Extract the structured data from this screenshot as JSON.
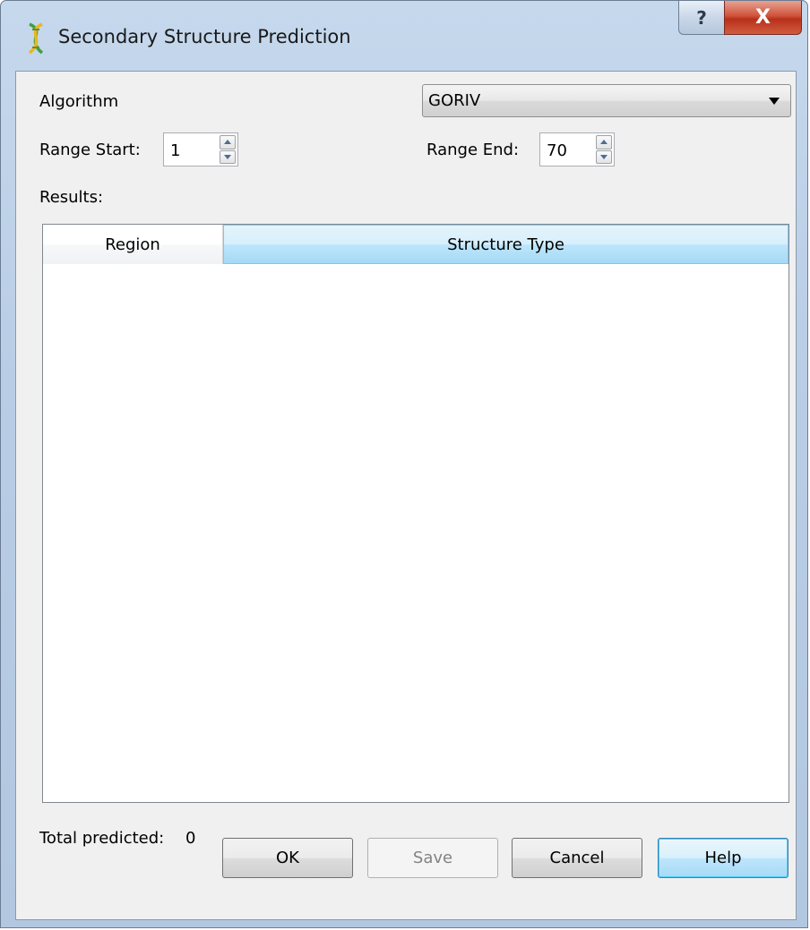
{
  "window": {
    "title": "Secondary Structure Prediction",
    "help_glyph": "?",
    "close_glyph": "X"
  },
  "form": {
    "algorithm_label": "Algorithm",
    "algorithm_value": "GORIV",
    "range_start_label": "Range Start:",
    "range_start_value": "1",
    "range_end_label": "Range End:",
    "range_end_value": "70",
    "results_label": "Results:"
  },
  "table": {
    "columns": [
      "Region",
      "Structure Type"
    ],
    "rows": []
  },
  "footer": {
    "total_label": "Total predicted:",
    "total_value": "0"
  },
  "buttons": {
    "ok": "OK",
    "save": "Save",
    "cancel": "Cancel",
    "help": "Help"
  },
  "icons": {
    "app": "dna-helix-icon",
    "dropdown": "chevron-down-icon",
    "spin_up": "arrow-up-icon",
    "spin_down": "arrow-down-icon"
  },
  "colors": {
    "close_button": "#c8452c",
    "selected_header": "#bde6fd",
    "focus_border": "#3c7fb1"
  }
}
